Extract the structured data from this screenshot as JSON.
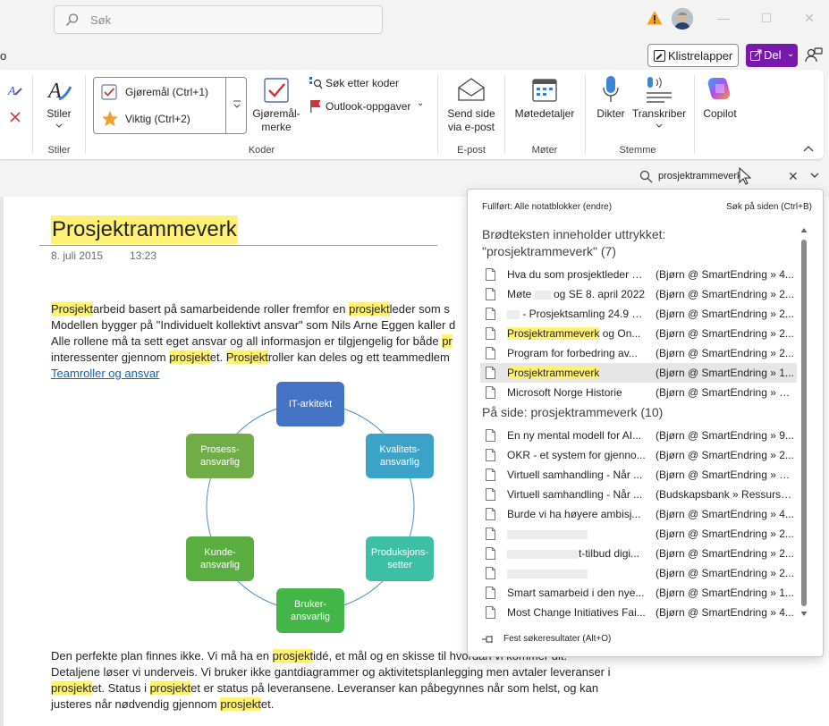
{
  "titlebar": {
    "search_placeholder": "Søk",
    "win_minimize": "—",
    "win_maximize": "☐",
    "win_close": "✕"
  },
  "subbar": {
    "left_fragment": "o",
    "sticky_notes": "Klistrelapper",
    "share": "Del"
  },
  "ribbon": {
    "styles_label": "Stiler",
    "styles_group": "Stiler",
    "tag_todo": "Gjøremål (Ctrl+1)",
    "tag_important": "Viktig (Ctrl+2)",
    "todo_tag_line1": "Gjøremål-",
    "todo_tag_line2": "merke",
    "find_tags": "Søk etter koder",
    "outlook_tasks": "Outlook-oppgaver",
    "tags_group": "Koder",
    "email_line1": "Send side",
    "email_line2": "via e-post",
    "email_group": "E-post",
    "meeting_details": "Møtedetaljer",
    "meetings_group": "Møter",
    "dictate": "Dikter",
    "transcribe": "Transkriber",
    "voice_group": "Stemme",
    "copilot": "Copilot"
  },
  "search": {
    "query": "prosjektrammeverk"
  },
  "page": {
    "title": "Prosjektrammeverk",
    "date": "8. juli 2015",
    "time": "13:23",
    "p1": {
      "a1": "Prosjekt",
      "a2": "arbeid basert på samarbeidende roller fremfor en ",
      "a3": "prosjekt",
      "a4": "leder som s"
    },
    "p2": "Modellen bygger på \"Individuelt kollektivt ansvar\" som Nils Arne Eggen kaller d",
    "p3": {
      "a1": "Alle rollene må ta sett eget ansvar og all informasjon er tilgjengelig for både ",
      "a2": "pr"
    },
    "p4": {
      "a1": "interessenter gjennom ",
      "a2": "prosjekt",
      "a3": "et.  ",
      "a4": "Prosjekt",
      "a5": "roller kan deles og ett teammedlem"
    },
    "link": "Teamroller og ansvar",
    "bottom1": {
      "a1": "Den perfekte plan finnes ikke. Vi må ha en ",
      "a2": "prosjekt",
      "a3": "idé, et mål og en skisse til hvordan vi kommer dit."
    },
    "bottom2": "Detaljene løser vi underveis. Vi bruker ikke gantdiagrammer og aktivitetsplanlegging men avtaler leveranser i",
    "bottom3": {
      "a1": "prosjekt",
      "a2": "et. Status i ",
      "a3": "prosjekt",
      "a4": "et er status på leveransene. Leveranser kan påbegynnes når som helst, og kan"
    },
    "bottom4": {
      "a1": "justeres når nødvendig gjennom ",
      "a2": "prosjekt",
      "a3": "et."
    }
  },
  "diagram": {
    "nodes": [
      {
        "label": "IT-arkitekt",
        "color": "#4472c4"
      },
      {
        "label": "Kvalitets-\nansvarlig",
        "color": "#3ba3c8"
      },
      {
        "label": "Produksjons-\nsetter",
        "color": "#3cbfa4"
      },
      {
        "label": "Bruker-\nansvarlig",
        "color": "#43b549"
      },
      {
        "label": "Kunde-\nansvarlig",
        "color": "#5aae3f"
      },
      {
        "label": "Prosess-\nansvarlig",
        "color": "#70ad47"
      }
    ]
  },
  "results": {
    "scope": "Fullført: Alle notatblokker (endre)",
    "search_on_page": "Søk på siden (Ctrl+B)",
    "body_heading_line1": "Brødteksten inneholder uttrykket:",
    "body_heading_line2": "\"prosjektrammeverk\" (7)",
    "body_items": [
      {
        "name": "Hva du som prosjektleder bør vite",
        "loc": "(Bjørn @ SmartEndring » 4..."
      },
      {
        "name_pre": "Møte ",
        "name_post": " og SE 8. april 2022",
        "loc": "(Bjørn @ SmartEndring » 2..."
      },
      {
        "name_post": " - Prosjektsamling 24.9 2...",
        "loc": "(Bjørn @ SmartEndring » 2..."
      },
      {
        "name_hl": "Prosjektrammeverk",
        "name_post": " og On...",
        "loc": "(Bjørn @ SmartEndring » 2..."
      },
      {
        "name": "Program for forbedring av...",
        "loc": "(Bjørn @ SmartEndring » 2..."
      },
      {
        "name_hl": "Prosjektrammeverk",
        "loc": "(Bjørn @ SmartEndring » 1...",
        "selected": true
      },
      {
        "name": "Microsoft Norge Historie",
        "loc": "(Bjørn @ SmartEndring » R..."
      }
    ],
    "page_heading": "På side: prosjektrammeverk (10)",
    "page_items": [
      {
        "name": "En ny mental modell for AI...",
        "loc": "(Bjørn @ SmartEndring » 9..."
      },
      {
        "name": "OKR - et system for gjenno...",
        "loc": "(Bjørn @ SmartEndring » 2..."
      },
      {
        "name": "Virtuell samhandling - Når ...",
        "loc": "(Bjørn @ SmartEndring » R..."
      },
      {
        "name": "Virtuell samhandling - Når ...",
        "loc": "(Budskapsbank » Ressursba..."
      },
      {
        "name": "Burde vi ha høyere ambisj...",
        "loc": "(Bjørn @ SmartEndring » 4..."
      },
      {
        "name": "",
        "loc": "(Bjørn @ SmartEndring » 2...",
        "blur": true
      },
      {
        "name_post": "t-tilbud digi...",
        "loc": "(Bjørn @ SmartEndring » 2...",
        "blur": true
      },
      {
        "name": "",
        "loc": "(Bjørn @ SmartEndring » 2...",
        "blur": true
      },
      {
        "name": "Smart samarbeid i den nye...",
        "loc": "(Bjørn @ SmartEndring » 1..."
      },
      {
        "name": "Most Change Initiatives Fai...",
        "loc": "(Bjørn @ SmartEndring » 4..."
      }
    ],
    "pin": "Fest søkeresultater (Alt+O)"
  }
}
